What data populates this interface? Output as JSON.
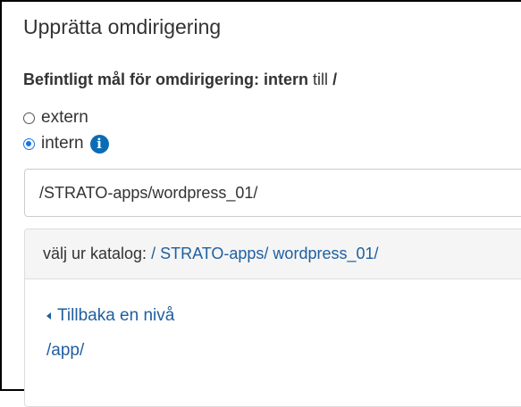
{
  "dialog": {
    "title": "Upprätta omdirigering"
  },
  "current_target": {
    "label": "Befintligt mål för omdirigering:",
    "type": "intern",
    "connector": "till",
    "path": "/"
  },
  "redirect_type": {
    "options": [
      {
        "label": "extern",
        "checked": false
      },
      {
        "label": "intern",
        "checked": true
      }
    ],
    "info_icon": "info-icon"
  },
  "path_input": {
    "value": "/STRATO-apps/wordpress_01/"
  },
  "directory_picker": {
    "label": "välj ur katalog:",
    "breadcrumb": "/ STRATO-apps/ wordpress_01/",
    "back_label": "Tillbaka en nivå",
    "entries": [
      "/app/"
    ]
  },
  "colors": {
    "link": "#1f5fa0",
    "info_icon": "#0b6cb6",
    "radio_selected": "#1a73e8"
  }
}
